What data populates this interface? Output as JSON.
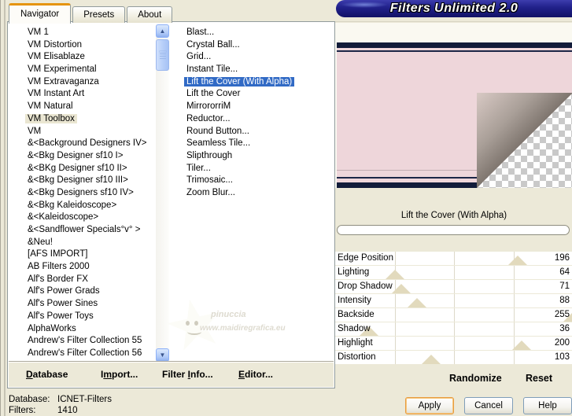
{
  "banner": {
    "title": "Filters Unlimited 2.0"
  },
  "tabs": [
    {
      "label": "Navigator",
      "active": true
    },
    {
      "label": "Presets",
      "active": false
    },
    {
      "label": "About",
      "active": false
    }
  ],
  "category_list": {
    "selected_index": 7,
    "items": [
      "VM 1",
      "VM Distortion",
      "VM Elisablaze",
      "VM Experimental",
      "VM Extravaganza",
      "VM Instant Art",
      "VM Natural",
      "VM Toolbox",
      "VM",
      "&<Background Designers IV>",
      "&<Bkg Designer sf10 I>",
      "&<BKg Designer sf10 II>",
      "&<Bkg Designer sf10 III>",
      "&<Bkg Designers sf10 IV>",
      "&<Bkg Kaleidoscope>",
      "&<Kaleidoscope>",
      "&<Sandflower Specials°v° >",
      "&Neu!",
      "[AFS IMPORT]",
      "AB Filters 2000",
      "Alf's Border FX",
      "Alf's Power Grads",
      "Alf's Power Sines",
      "Alf's Power Toys",
      "AlphaWorks",
      "Andrew's Filter Collection 55",
      "Andrew's Filter Collection 56"
    ]
  },
  "filter_list": {
    "selected_index": 4,
    "items": [
      "Blast...",
      "Crystal Ball...",
      "Grid...",
      "Instant Tile...",
      "Lift the Cover (With Alpha)",
      "Lift the Cover",
      "MirrororriM",
      "Reductor...",
      "Round Button...",
      "Seamless Tile...",
      "Slipthrough",
      "Tiler...",
      "Trimosaic...",
      "Zoom Blur..."
    ]
  },
  "icons": {
    "scroll_up": "▲",
    "scroll_down": "▼"
  },
  "preview": {
    "caption": "Lift the Cover (With Alpha)",
    "progress_value": 0
  },
  "sliders": {
    "max": 255,
    "items": [
      {
        "label": "Edge Position",
        "value": 196
      },
      {
        "label": "Lighting",
        "value": 64
      },
      {
        "label": "Drop Shadow",
        "value": 71
      },
      {
        "label": "Intensity",
        "value": 88
      },
      {
        "label": "Backside",
        "value": 255
      },
      {
        "label": "Shadow",
        "value": 36
      },
      {
        "label": "Highlight",
        "value": 200
      },
      {
        "label": "Distortion",
        "value": 103
      }
    ]
  },
  "actions": {
    "randomize": "Randomize",
    "reset": "Reset"
  },
  "toolbar": {
    "items": [
      {
        "label": "Database",
        "hotkey_index": 0
      },
      {
        "label": "Import...",
        "hotkey_index": 1
      },
      {
        "label": "Filter Info...",
        "hotkey_index": 7
      },
      {
        "label": "Editor...",
        "hotkey_index": 0
      }
    ]
  },
  "status": {
    "rows": [
      {
        "label": "Database:",
        "value": "ICNET-Filters"
      },
      {
        "label": "Filters:",
        "value": "1410"
      }
    ]
  },
  "buttons": [
    {
      "label": "Apply",
      "focused": true
    },
    {
      "label": "Cancel",
      "focused": false
    },
    {
      "label": "Help",
      "focused": false
    }
  ],
  "watermark": {
    "line1": "pinuccia",
    "line2": "www.maidiregrafica.eu"
  },
  "colors": {
    "dialog_bg": "#ece9d8",
    "banner_navy": "#22228c",
    "selection_blue": "#316ac5",
    "category_highlight": "#eae6d2",
    "tab_active_orange": "#e5940e",
    "apply_focus_orange": "#e79b3f",
    "preview_pink": "#eed6da",
    "preview_navy": "#121c3a",
    "slider_thumb_tan": "#e2dabd"
  }
}
